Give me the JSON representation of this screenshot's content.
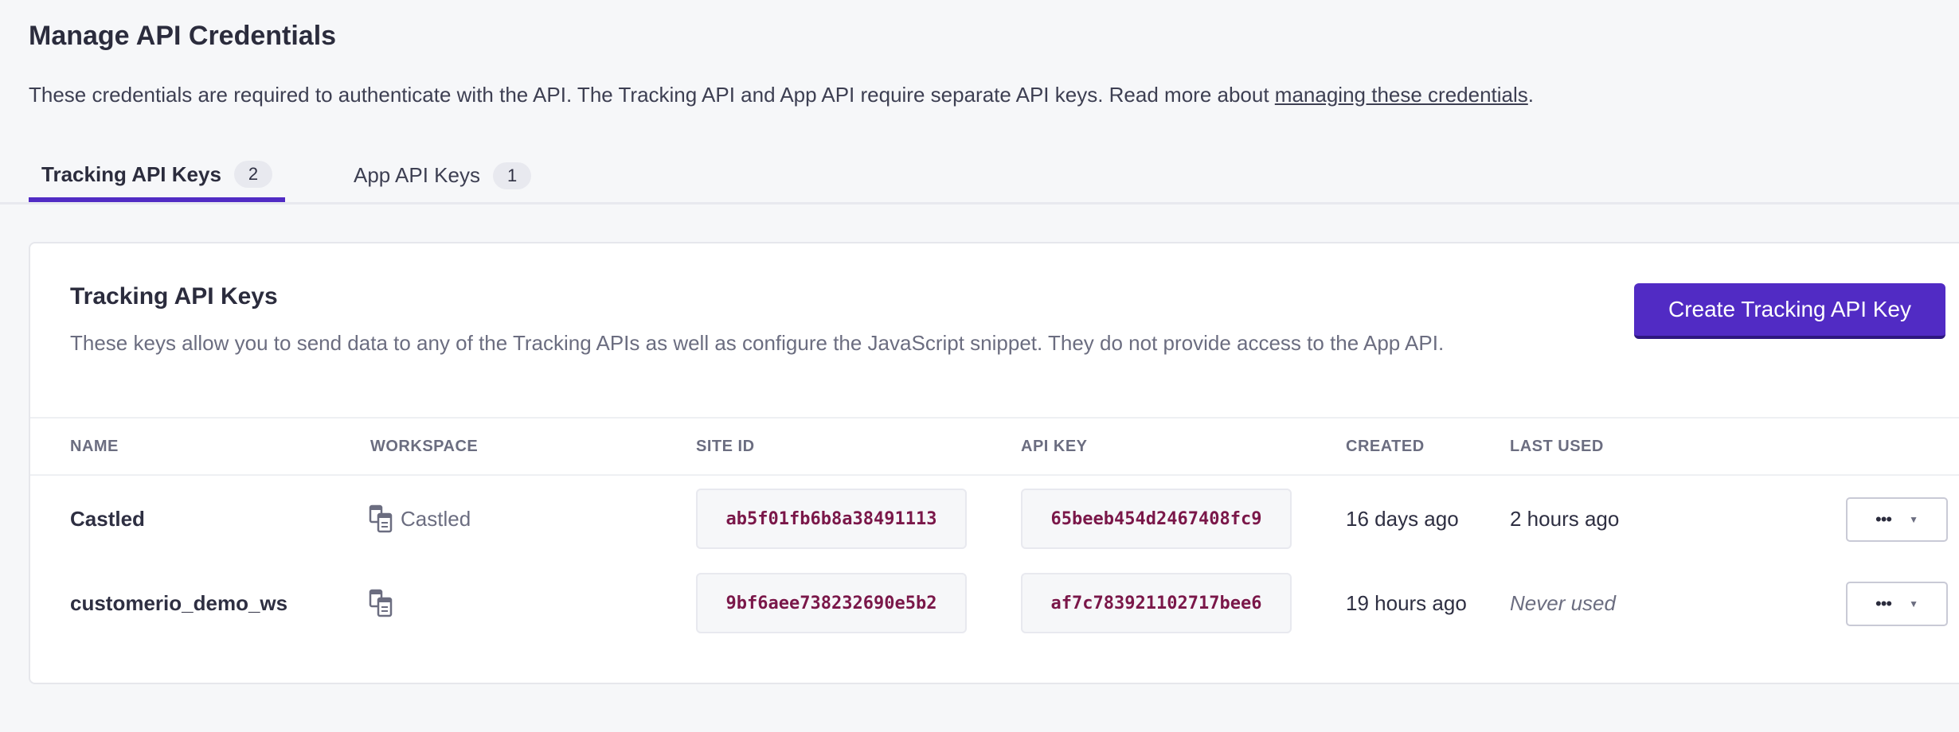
{
  "page": {
    "title": "Manage API Credentials",
    "description_prefix": "These credentials are required to authenticate with the API. The Tracking API and App API require separate API keys. Read more about ",
    "description_link": "managing these credentials",
    "description_suffix": "."
  },
  "tabs": [
    {
      "label": "Tracking API Keys",
      "count": "2",
      "active": true
    },
    {
      "label": "App API Keys",
      "count": "1",
      "active": false
    }
  ],
  "card": {
    "title": "Tracking API Keys",
    "description": "These keys allow you to send data to any of the Tracking APIs as well as configure the JavaScript snippet. They do not provide access to the App API.",
    "create_button": "Create Tracking API Key"
  },
  "table": {
    "headers": [
      "NAME",
      "WORKSPACE",
      "SITE ID",
      "API KEY",
      "CREATED",
      "LAST USED"
    ],
    "rows": [
      {
        "name": "Castled",
        "workspace": "Castled",
        "site_id": "ab5f01fb6b8a38491113",
        "api_key": "65beeb454d2467408fc9",
        "created": "16 days ago",
        "last_used": "2 hours ago",
        "actions": "•••"
      },
      {
        "name": "customerio_demo_ws",
        "workspace": "",
        "site_id": "9bf6aee738232690e5b2",
        "api_key": "af7c783921102717bee6",
        "created": "19 hours ago",
        "last_used": "Never used",
        "actions": "•••"
      }
    ]
  },
  "colors": {
    "accent": "#512bc4",
    "code": "#7a1749"
  }
}
